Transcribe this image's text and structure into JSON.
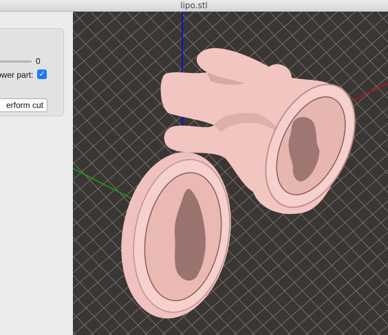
{
  "window": {
    "title": "lipo.stl"
  },
  "cut_panel": {
    "slider_value": "0",
    "lower_part_label": "ower part:",
    "lower_part_checked": true,
    "perform_cut_label": "erform cut"
  },
  "viewport": {
    "background": "#3a3634",
    "grid_color": "#8f8b88",
    "axis_colors": {
      "x": "#cc1111",
      "y": "#11aa11",
      "z": "#1111cc"
    },
    "model_color": "#f2c5c1"
  }
}
